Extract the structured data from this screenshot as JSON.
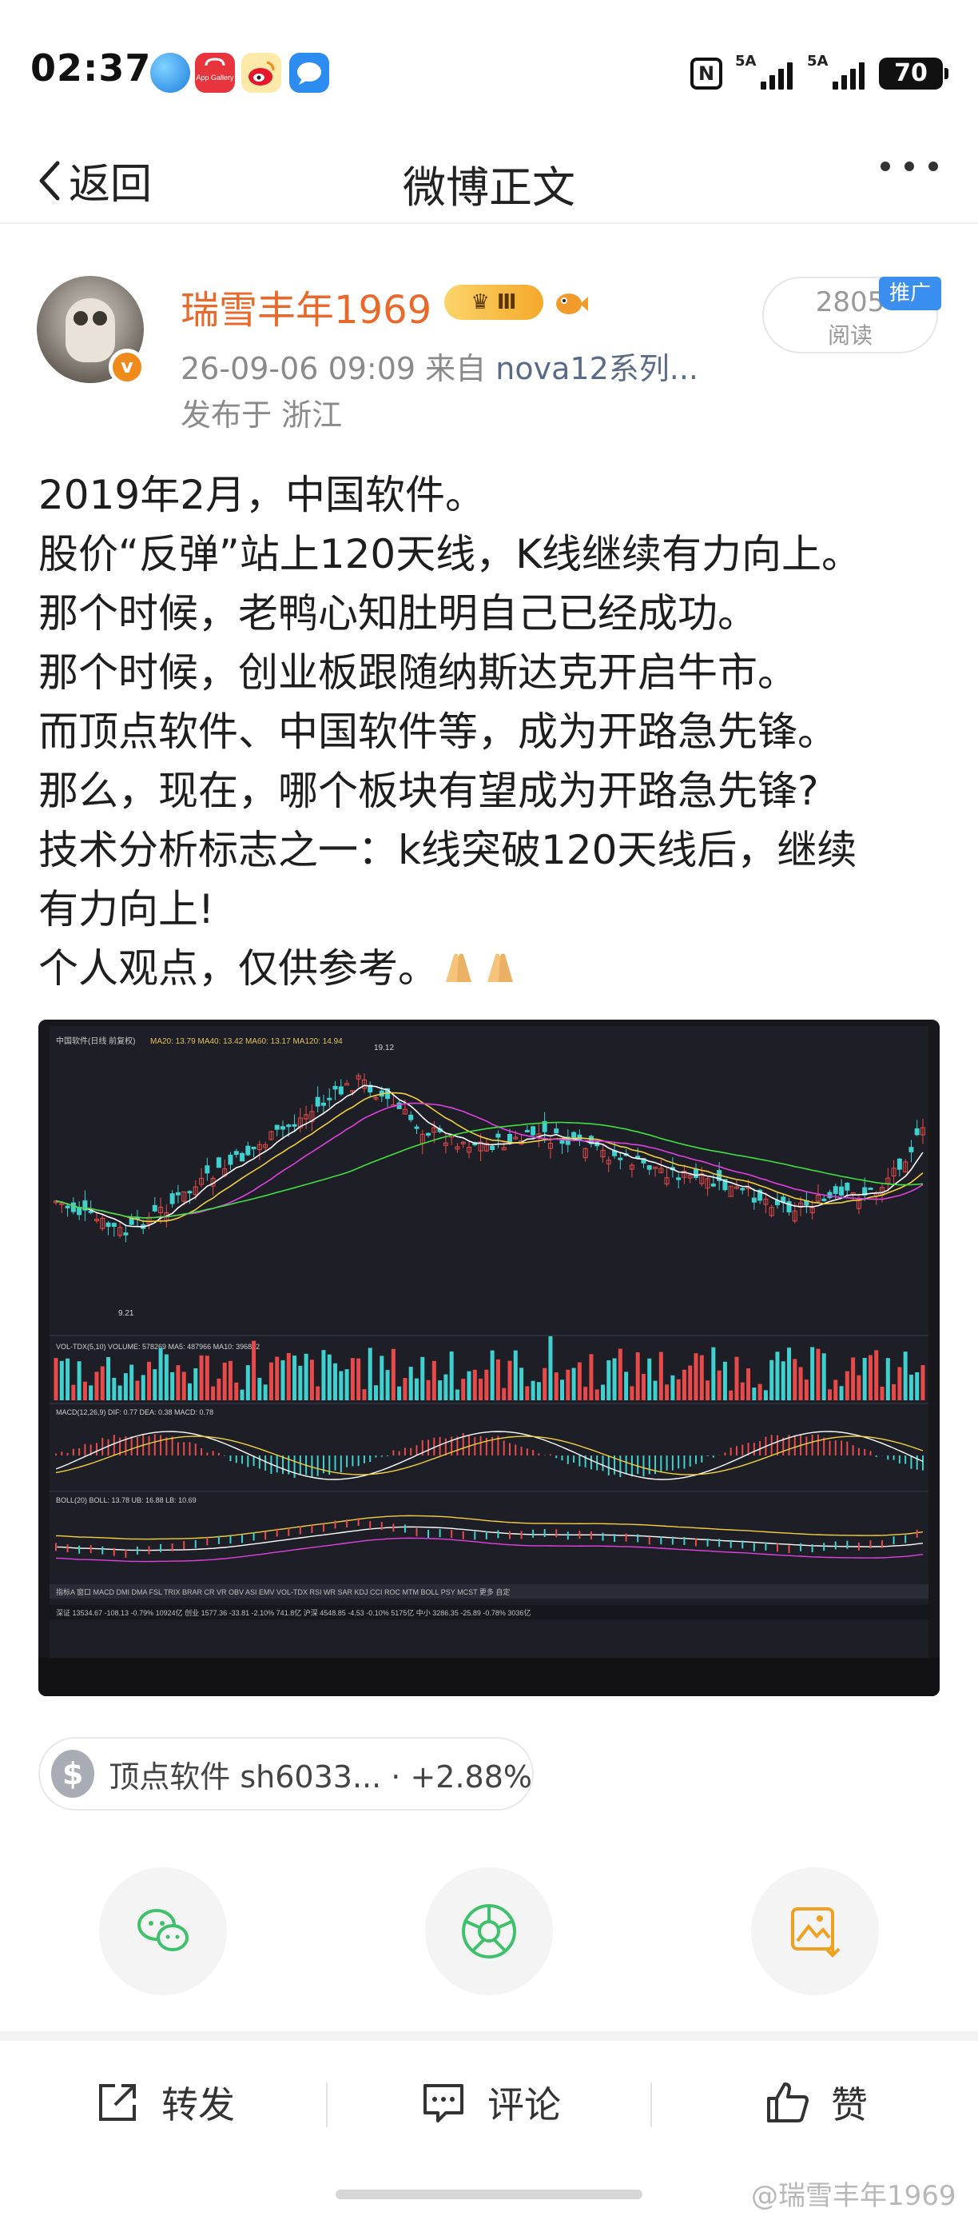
{
  "status_bar": {
    "time": "02:37",
    "nfc_label": "N",
    "signal_1": "5A",
    "signal_2": "5A",
    "battery": "70",
    "app_icons": [
      "browser-icon",
      "app-gallery-icon",
      "weibo-icon",
      "message-icon"
    ],
    "app_gallery_label": "App Gallery"
  },
  "nav": {
    "back_label": "返回",
    "title": "微博正文"
  },
  "post": {
    "username": "瑞雪丰年1969",
    "vip_level": "Ⅲ",
    "time_prefix": "26-09-06 09:09",
    "from_label": "来自",
    "source": "nova12系列...",
    "location": "发布于 浙江",
    "reads_count": "2805",
    "reads_label": "阅读",
    "promo_tag": "推广",
    "lines": [
      "2019年2月，中国软件。",
      "股价“反弹”站上120天线，K线继续有力向上。",
      "那个时候，老鸭心知肚明自己已经成功。",
      "那个时候，创业板跟随纳斯达克开启牛市。",
      "而顶点软件、中国软件等，成为开路急先锋。",
      "那么，现在，哪个板块有望成为开路急先锋?",
      "技术分析标志之一：k线突破120天线后，继续",
      "有力向上!",
      "个人观点，仅供参考。"
    ]
  },
  "photo": {
    "chart_title": "中国软件(日线 前复权)",
    "ma_labels": "MA20: 13.79  MA40: 13.42  MA60: 13.17  MA120: 14.94",
    "high_label": "19.12",
    "low_label": "9.21",
    "vol_label": "VOL-TDX(5,10) VOLUME: 578269  MA5: 487966  MA10: 396882",
    "macd_label": "MACD(12,26,9) DIF: 0.77  DEA: 0.38  MACD: 0.78",
    "boll_label": "BOLL(20) BOLL: 13.78  UB: 16.88  LB: 10.69",
    "indicator_tabs": "指标A  窗口  MACD  DMI  DMA  FSL  TRIX  BRAR  CR  VR  OBV  ASI  EMV  VOL-TDX  RSI  WR  SAR  KDJ  CCI  ROC  MTM  BOLL  PSY  MCST  更多  自定",
    "bottom_ticker": "深证 13534.67 -108.13 -0.79% 10924亿  创业 1577.36 -33.81 -2.10% 741.8亿  沪深 4548.85 -4.53 -0.10% 5175亿  中小 3286.35 -25.89 -0.78% 3036亿"
  },
  "stock_tag": {
    "icon": "$",
    "text": "顶点软件 sh6033... · +2.88%"
  },
  "share": {
    "buttons": [
      "wechat-icon",
      "moments-icon",
      "save-image-icon"
    ]
  },
  "bottom_bar": {
    "repost_label": "转发",
    "comment_label": "评论",
    "like_label": "赞"
  },
  "watermark": "@瑞雪丰年1969",
  "colors": {
    "username": "#e8692a",
    "wechat": "#3fc16b",
    "save": "#f0a020",
    "promo": "#3a8ef0"
  }
}
